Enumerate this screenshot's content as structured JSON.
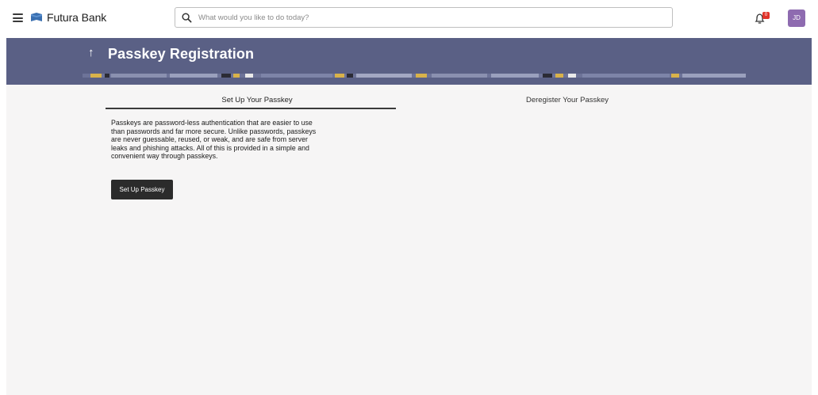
{
  "header": {
    "brand": "Futura Bank",
    "search_placeholder": "What would you like to do today?",
    "notification_count": "0",
    "user_initials": "JD",
    "icons": [
      "hamburger-icon",
      "futura-logo-icon",
      "search-icon",
      "bell-icon"
    ]
  },
  "banner": {
    "title": "Passkey Registration",
    "back_glyph": "↑"
  },
  "tabs": [
    {
      "label": "Set Up Your Passkey",
      "active": true
    },
    {
      "label": "Deregister Your Passkey",
      "active": false
    }
  ],
  "setup": {
    "description": "Passkeys are password-less authentication that are easier to use than passwords and far more secure. Unlike passwords, passkeys are never guessable, reused, or weak, and are safe from server leaks and phishing attacks. All of this is provided in a simple and convenient way through passkeys.",
    "button_label": "Set Up Passkey"
  },
  "colors": {
    "banner": "#5a6085",
    "avatar": "#8e6bb0",
    "badge": "#e0332a",
    "button": "#2b2b2b",
    "content_bg": "#f6f5f5"
  }
}
